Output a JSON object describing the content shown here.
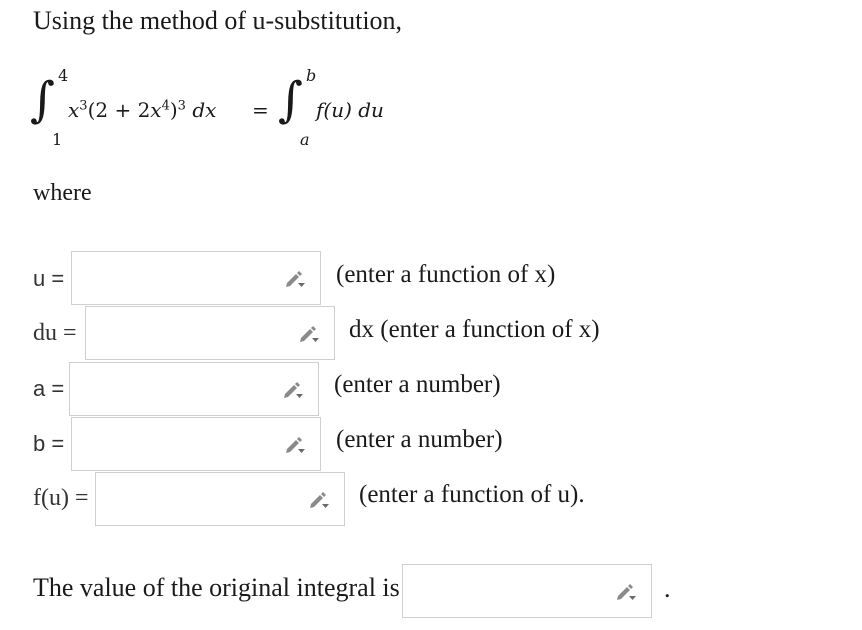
{
  "intro": "Using the method of u-substitution,",
  "integral": {
    "left_upper": "4",
    "left_lower": "1",
    "left_integrand_a": "x",
    "left_exp_a": "3",
    "left_integrand_b": "(2 + 2",
    "left_integrand_c": "x",
    "left_exp_b": "4",
    "left_integrand_d": ")",
    "left_exp_c": "3",
    "left_d": "dx",
    "equals": "=",
    "right_upper": "b",
    "right_lower": "a",
    "right_integrand": "f(u)",
    "right_d": "du"
  },
  "where": "where",
  "rows": [
    {
      "label": "u =",
      "value": "",
      "hint": "(enter a function of x)"
    },
    {
      "label": "du =",
      "value": "",
      "hint": "dx (enter a function of x)"
    },
    {
      "label": "a =",
      "value": "",
      "hint": "(enter a number)"
    },
    {
      "label": "b =",
      "value": "",
      "hint": "(enter a number)"
    },
    {
      "label": "f(u) =",
      "value": "",
      "hint": "(enter a function of u)."
    }
  ],
  "final": {
    "label": "The value of the original integral is",
    "value": "",
    "period": "."
  },
  "icons": {
    "answer_tool": "pencil-dropdown-icon"
  },
  "colors": {
    "text": "#1a1a1a",
    "border": "#d0d0d0",
    "icon": "#8a8a8a"
  }
}
